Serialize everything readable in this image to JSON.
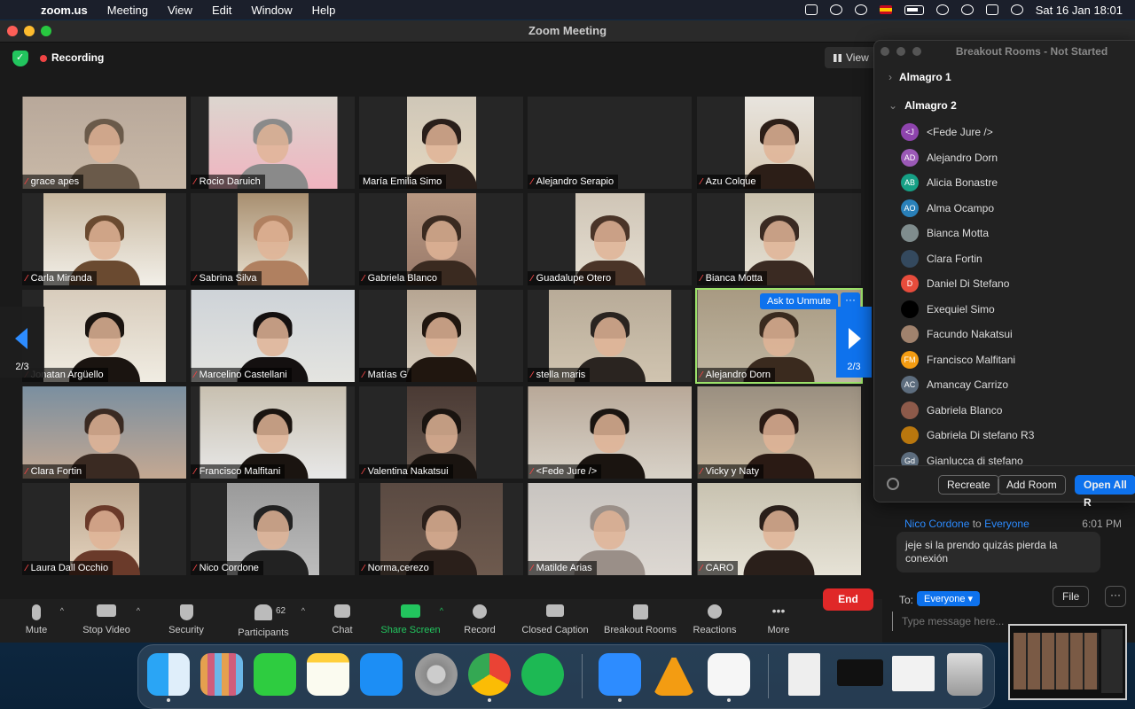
{
  "menubar": {
    "app": "zoom.us",
    "items": [
      "Meeting",
      "View",
      "Edit",
      "Window",
      "Help"
    ],
    "clock": "Sat 16 Jan  18:01"
  },
  "window": {
    "title": "Zoom Meeting",
    "recording": "Recording",
    "view_label": "View"
  },
  "tiles": [
    {
      "name": "grace apes",
      "muted": true
    },
    {
      "name": "Rocio Daruich",
      "muted": true
    },
    {
      "name": "María Emilia Simo",
      "muted": false
    },
    {
      "name": "Alejandro Serapio",
      "muted": true
    },
    {
      "name": "Azu Colque",
      "muted": true
    },
    {
      "name": "Carla Miranda",
      "muted": true
    },
    {
      "name": "Sabrina Silva",
      "muted": true
    },
    {
      "name": "Gabriela Blanco",
      "muted": true
    },
    {
      "name": "Guadalupe Otero",
      "muted": true
    },
    {
      "name": "Bianca Motta",
      "muted": true
    },
    {
      "name": "Jonatan Argüello",
      "muted": true
    },
    {
      "name": "Marcelino Castellani",
      "muted": true
    },
    {
      "name": "Matías G",
      "muted": true
    },
    {
      "name": "stella maris",
      "muted": true
    },
    {
      "name": "Alejandro Dorn",
      "muted": true
    },
    {
      "name": "Clara Fortin",
      "muted": true
    },
    {
      "name": "Francisco Malfitani",
      "muted": true
    },
    {
      "name": "Valentina Nakatsui",
      "muted": true
    },
    {
      "name": "<Fede Jure />",
      "muted": true
    },
    {
      "name": "Vicky y Naty",
      "muted": true
    },
    {
      "name": "Laura Dall Occhio",
      "muted": true
    },
    {
      "name": "Nico Cordone",
      "muted": true
    },
    {
      "name": "Norma,cerezo",
      "muted": true
    },
    {
      "name": "Matilde Arias",
      "muted": true
    },
    {
      "name": "CARO",
      "muted": true
    }
  ],
  "tile_overlay": {
    "ask_to_unmute": "Ask to Unmute",
    "more": "···"
  },
  "pager": {
    "left": "2/3",
    "right": "2/3"
  },
  "toolbar": {
    "mute": "Mute",
    "stop_video": "Stop Video",
    "security": "Security",
    "participants": "Participants",
    "participants_count": "62",
    "chat": "Chat",
    "share_screen": "Share Screen",
    "record": "Record",
    "closed_caption": "Closed Caption",
    "breakout_rooms": "Breakout Rooms",
    "reactions": "Reactions",
    "more": "More",
    "end": "End"
  },
  "breakout": {
    "title": "Breakout Rooms - Not Started",
    "rooms": [
      "Almagro 1",
      "Almagro 2"
    ],
    "participants": [
      {
        "initials": "<J",
        "name": "<Fede Jure />",
        "color": "#8e44ad"
      },
      {
        "initials": "AD",
        "name": "Alejandro Dorn",
        "color": "#9b59b6"
      },
      {
        "initials": "AB",
        "name": "Alicia Bonastre",
        "color": "#16a085"
      },
      {
        "initials": "AO",
        "name": "Alma Ocampo",
        "color": "#2980b9"
      },
      {
        "initials": "",
        "name": "Bianca Motta",
        "color": "#7f8c8d"
      },
      {
        "initials": "",
        "name": "Clara Fortin",
        "color": "#34495e"
      },
      {
        "initials": "D",
        "name": "Daniel Di Stefano",
        "color": "#e74c3c"
      },
      {
        "initials": "",
        "name": "Exequiel Simo",
        "color": "#000000"
      },
      {
        "initials": "",
        "name": "Facundo Nakatsui",
        "color": "#a0826d"
      },
      {
        "initials": "FM",
        "name": "Francisco Malfitani",
        "color": "#f39c12"
      },
      {
        "initials": "AC",
        "name": "Amancay Carrizo",
        "color": "#5d6d7e"
      },
      {
        "initials": "",
        "name": "Gabriela Blanco",
        "color": "#8d5a4a"
      },
      {
        "initials": "",
        "name": "Gabriela Di stefano R3",
        "color": "#b9770e"
      },
      {
        "initials": "Gd",
        "name": "Gianlucca di stefano",
        "color": "#5d6d7e"
      }
    ],
    "recreate": "Recreate",
    "add_room": "Add Room",
    "open_all": "Open All R"
  },
  "chat": {
    "sender": "Nico Cordone",
    "to_word": "to",
    "recipient": "Everyone",
    "time": "6:01 PM",
    "message": "jeje si la prendo quizás pierda la conexión",
    "to_label": "To:",
    "to_select": "Everyone ▾",
    "file": "File",
    "more": "···",
    "placeholder": "Type message here..."
  }
}
